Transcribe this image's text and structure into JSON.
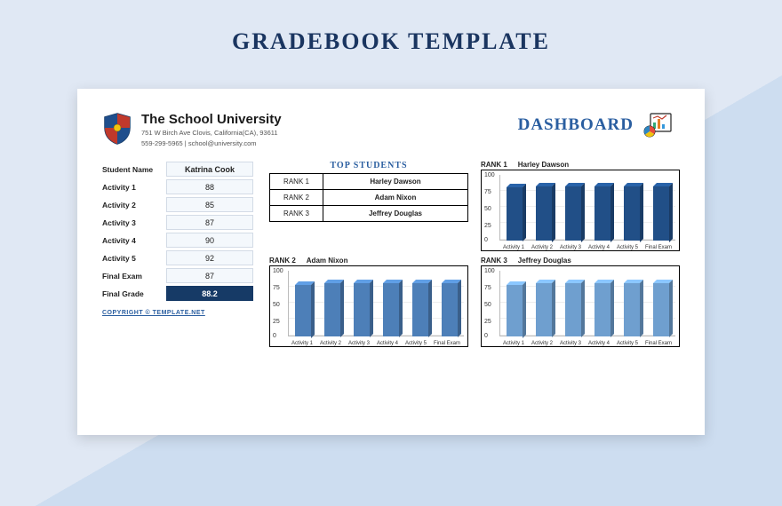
{
  "page_title": "GRADEBOOK TEMPLATE",
  "school": {
    "name": "The School University",
    "address_line1": "751 W Birch Ave Clovis, California(CA), 93611",
    "address_line2": "559-299-5965 | school@university.com"
  },
  "dashboard_label": "DASHBOARD",
  "student": {
    "name_label": "Student Name",
    "name": "Katrina Cook",
    "rows": [
      {
        "label": "Activity 1",
        "value": "88"
      },
      {
        "label": "Activity 2",
        "value": "85"
      },
      {
        "label": "Activity 3",
        "value": "87"
      },
      {
        "label": "Activity 4",
        "value": "90"
      },
      {
        "label": "Activity 5",
        "value": "92"
      },
      {
        "label": "Final Exam",
        "value": "87"
      }
    ],
    "final_label": "Final Grade",
    "final_value": "88.2"
  },
  "copyright": "COPYRIGHT © TEMPLATE.NET",
  "top_students": {
    "title": "TOP STUDENTS",
    "ranks": [
      {
        "rank": "RANK 1",
        "name": "Harley Dawson"
      },
      {
        "rank": "RANK 2",
        "name": "Adam Nixon"
      },
      {
        "rank": "RANK 3",
        "name": "Jeffrey Douglas"
      }
    ]
  },
  "chart_data": [
    {
      "type": "bar",
      "rank_label": "RANK 1",
      "title": "Harley Dawson",
      "categories": [
        "Activity 1",
        "Activity 2",
        "Activity 3",
        "Activity 4",
        "Activity 5",
        "Final Exam"
      ],
      "values": [
        80,
        82,
        82,
        82,
        82,
        82
      ],
      "ylim": [
        0,
        100
      ],
      "yticks": [
        0,
        25,
        50,
        75,
        100
      ],
      "color": "#214f87"
    },
    {
      "type": "bar",
      "rank_label": "RANK 2",
      "title": "Adam Nixon",
      "categories": [
        "Activity 1",
        "Activity 2",
        "Activity 3",
        "Activity 4",
        "Activity 5",
        "Final Exam"
      ],
      "values": [
        78,
        80,
        80,
        80,
        80,
        80
      ],
      "ylim": [
        0,
        100
      ],
      "yticks": [
        0,
        25,
        50,
        75,
        100
      ],
      "color": "#4d7fb8"
    },
    {
      "type": "bar",
      "rank_label": "RANK 3",
      "title": "Jeffrey Douglas",
      "categories": [
        "Activity 1",
        "Activity 2",
        "Activity 3",
        "Activity 4",
        "Activity 5",
        "Final Exam"
      ],
      "values": [
        78,
        80,
        80,
        80,
        80,
        80
      ],
      "ylim": [
        0,
        100
      ],
      "yticks": [
        0,
        25,
        50,
        75,
        100
      ],
      "color": "#6f9fcf"
    }
  ]
}
